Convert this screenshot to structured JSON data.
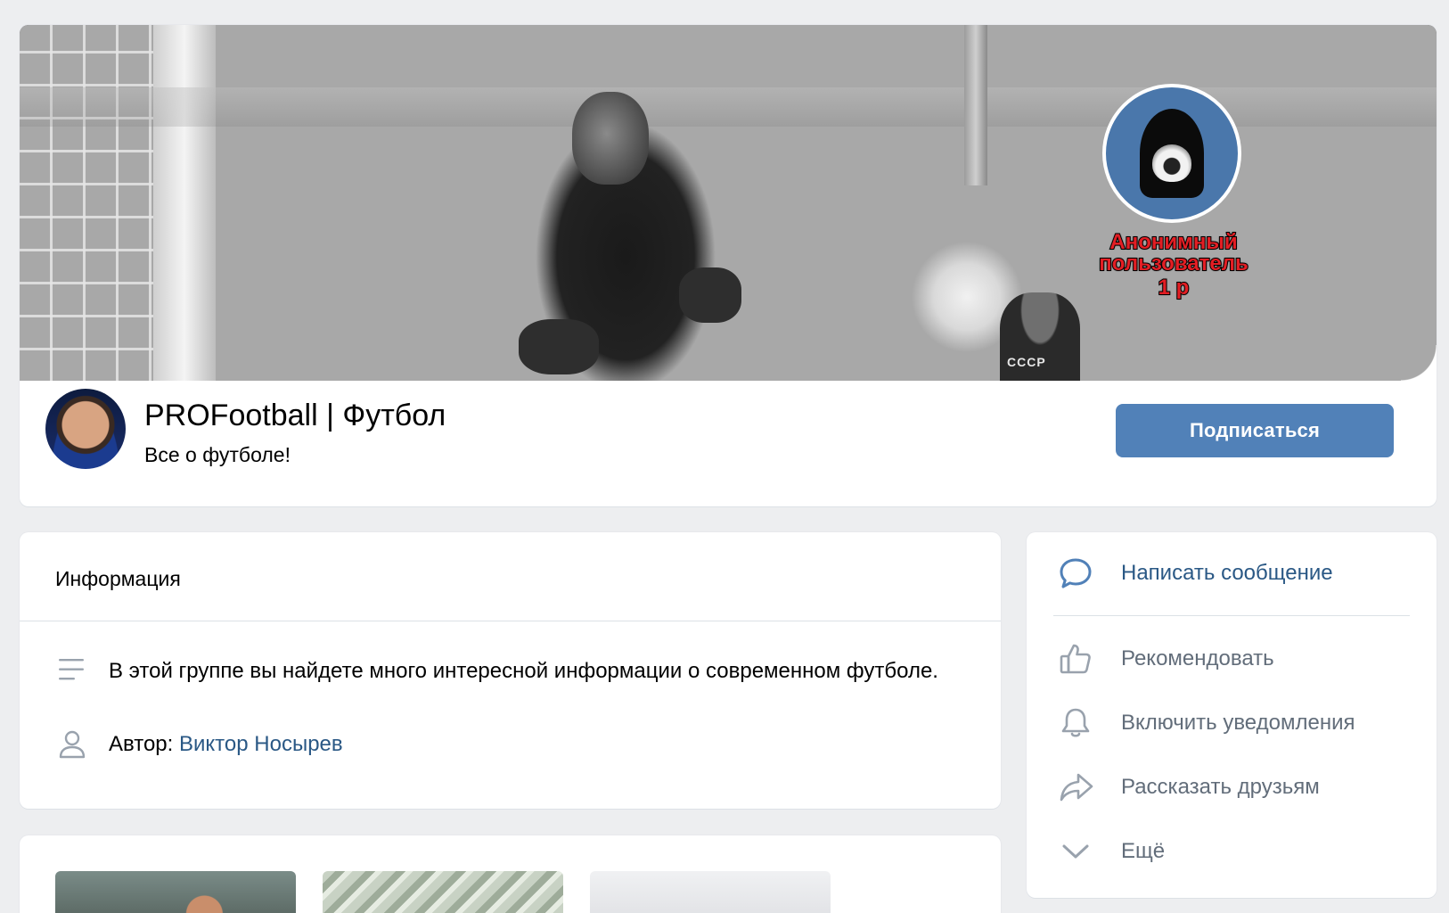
{
  "header": {
    "cover_overlay": {
      "line1": "Анонимный",
      "line2": "пользователь",
      "price": "1 р"
    },
    "group_name": "PROFootball | Футбол",
    "group_status": "Все о футболе!",
    "subscribe_label": "Подписаться",
    "cover_badge_text": "СССР"
  },
  "info": {
    "title": "Информация",
    "description": "В этой группе вы найдете много интересной информации о современном футболе.",
    "author_label": "Автор:",
    "author_name": "Виктор Носырев"
  },
  "actions": {
    "items": [
      {
        "label": "Написать сообщение",
        "icon": "message-icon"
      },
      {
        "label": "Рекомендовать",
        "icon": "thumbs-up-icon"
      },
      {
        "label": "Включить уведомления",
        "icon": "bell-icon"
      },
      {
        "label": "Рассказать друзьям",
        "icon": "share-icon"
      },
      {
        "label": "Ещё",
        "icon": "chevron-down-icon"
      }
    ]
  },
  "colors": {
    "accent": "#5181b8",
    "link": "#2a5885",
    "muted_text": "#626d7a",
    "page_bg": "#edeef0",
    "overlay_text": "#e31e24"
  }
}
